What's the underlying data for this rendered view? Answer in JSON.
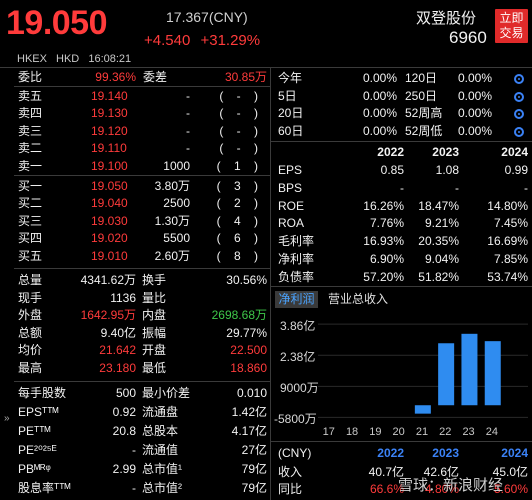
{
  "header": {
    "price": "19.050",
    "reference": "17.367(CNY)",
    "change": "+4.540",
    "change_pct": "+31.29%",
    "name": "双登股份",
    "code": "6960",
    "trade_button": "立即\n交易",
    "exchange": "HKEX",
    "currency": "HKD",
    "time": "16:08:21",
    "colors": {
      "up": "#ff3b3b",
      "down": "#3ec84a",
      "accent": "#3b82f6"
    }
  },
  "order_book": {
    "commission": {
      "label": "委比",
      "value": "99.36%",
      "diff_label": "委差",
      "diff_value": "30.85万"
    },
    "asks": [
      {
        "label": "卖五",
        "price": "19.140",
        "volume": "-",
        "orders": "(    -    )"
      },
      {
        "label": "卖四",
        "price": "19.130",
        "volume": "-",
        "orders": "(    -    )"
      },
      {
        "label": "卖三",
        "price": "19.120",
        "volume": "-",
        "orders": "(    -    )"
      },
      {
        "label": "卖二",
        "price": "19.110",
        "volume": "-",
        "orders": "(    -    )"
      },
      {
        "label": "卖一",
        "price": "19.100",
        "volume": "1000",
        "orders": "(    1    )"
      }
    ],
    "bids": [
      {
        "label": "买一",
        "price": "19.050",
        "volume": "3.80万",
        "orders": "(    3    )"
      },
      {
        "label": "买二",
        "price": "19.040",
        "volume": "2500",
        "orders": "(    2    )"
      },
      {
        "label": "买三",
        "price": "19.030",
        "volume": "1.30万",
        "orders": "(    4    )"
      },
      {
        "label": "买四",
        "price": "19.020",
        "volume": "5500",
        "orders": "(    6    )"
      },
      {
        "label": "买五",
        "price": "19.010",
        "volume": "2.60万",
        "orders": "(    8    )"
      }
    ]
  },
  "stats": [
    {
      "l1": "总量",
      "v1": "4341.62万",
      "c1": "white",
      "l2": "换手",
      "v2": "30.56%",
      "c2": "white"
    },
    {
      "l1": "现手",
      "v1": "1136",
      "c1": "white",
      "l2": "量比",
      "v2": "",
      "c2": "white"
    },
    {
      "l1": "外盘",
      "v1": "1642.95万",
      "c1": "red",
      "l2": "内盘",
      "v2": "2698.68万",
      "c2": "green"
    },
    {
      "l1": "总额",
      "v1": "9.40亿",
      "c1": "white",
      "l2": "振幅",
      "v2": "29.77%",
      "c2": "white"
    },
    {
      "l1": "均价",
      "v1": "21.642",
      "c1": "red",
      "l2": "开盘",
      "v2": "22.500",
      "c2": "red"
    },
    {
      "l1": "最高",
      "v1": "23.180",
      "c1": "red",
      "l2": "最低",
      "v2": "18.860",
      "c2": "red"
    }
  ],
  "stats2": [
    {
      "l1": "每手股数",
      "v1": "500",
      "l2": "最小价差",
      "v2": "0.010"
    },
    {
      "l1": "EPSᵀᵀᴹ",
      "v1": "0.92",
      "l2": "流通盘",
      "v2": "1.42亿"
    },
    {
      "l1": "PEᵀᵀᴹ",
      "v1": "20.8",
      "l2": "总股本",
      "v2": "4.17亿"
    },
    {
      "l1": "PE²⁰²⁵ᴱ",
      "v1": "-",
      "l2": "流通值",
      "v2": "27亿"
    },
    {
      "l1": "PBᴹᴿᵠ",
      "v1": "2.99",
      "l2": "总市值¹",
      "v2": "79亿"
    },
    {
      "l1": "股息率ᵀᵀᴹ",
      "v1": "-",
      "l2": "总市值²",
      "v2": "79亿"
    }
  ],
  "performance": [
    {
      "l1": "今年",
      "v1": "0.00%",
      "l2": "120日",
      "v2": "0.00%"
    },
    {
      "l1": "5日",
      "v1": "0.00%",
      "l2": "250日",
      "v2": "0.00%"
    },
    {
      "l1": "20日",
      "v1": "0.00%",
      "l2": "52周高",
      "v2": "0.00%"
    },
    {
      "l1": "60日",
      "v1": "0.00%",
      "l2": "52周低",
      "v2": "0.00%"
    }
  ],
  "financials": {
    "years": [
      "2022",
      "2023",
      "2024"
    ],
    "rows": [
      {
        "label": "EPS",
        "values": [
          "0.85",
          "1.08",
          "0.99"
        ]
      },
      {
        "label": "BPS",
        "values": [
          "-",
          "-",
          "-"
        ]
      },
      {
        "label": "ROE",
        "values": [
          "16.26%",
          "18.47%",
          "14.80%"
        ]
      },
      {
        "label": "ROA",
        "values": [
          "7.76%",
          "9.21%",
          "7.45%"
        ]
      },
      {
        "label": "毛利率",
        "values": [
          "16.93%",
          "20.35%",
          "16.69%"
        ]
      },
      {
        "label": "净利率",
        "values": [
          "6.90%",
          "9.04%",
          "7.85%"
        ]
      },
      {
        "label": "负债率",
        "values": [
          "57.20%",
          "51.82%",
          "53.74%"
        ]
      }
    ]
  },
  "tabs": {
    "active": "净利润",
    "other": "营业总收入"
  },
  "chart_data": {
    "type": "bar",
    "categories": [
      "17",
      "18",
      "19",
      "20",
      "21",
      "22",
      "23",
      "24"
    ],
    "values": [
      0,
      0,
      0,
      0,
      -0.4,
      2.95,
      3.4,
      3.05
    ],
    "yticks": [
      "3.86亿",
      "2.38亿",
      "9000万",
      "-5800万"
    ],
    "ytick_values": [
      3.86,
      2.38,
      0.9,
      -0.58
    ],
    "ylim": [
      -0.75,
      4.2
    ]
  },
  "revenue": {
    "currency": "(CNY)",
    "years": [
      "2022",
      "2023",
      "2024"
    ],
    "rows": [
      {
        "label": "收入",
        "values": [
          "40.7亿",
          "42.6亿",
          "45.0亿"
        ]
      },
      {
        "label": "同比",
        "values": [
          "66.6%",
          "4.80%",
          "5.60%"
        ]
      }
    ]
  },
  "watermark": "雪球：新浪财经",
  "side_arrow": "»"
}
